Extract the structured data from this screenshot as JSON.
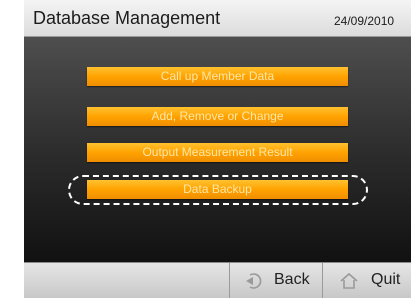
{
  "header": {
    "title": "Database Management",
    "date": "24/09/2010"
  },
  "menu": {
    "items": [
      {
        "label": "Call up Member Data"
      },
      {
        "label": "Add, Remove or Change"
      },
      {
        "label": "Output Measurement Result"
      },
      {
        "label": "Data Backup"
      }
    ],
    "selected_index": 3
  },
  "footer": {
    "back_label": "Back",
    "back_icon": "back-arrow-icon",
    "quit_label": "Quit",
    "quit_icon": "home-icon"
  },
  "colors": {
    "accent": "#ffa200",
    "button_text": "#ffe7a6",
    "background": "#2a2a2a"
  }
}
